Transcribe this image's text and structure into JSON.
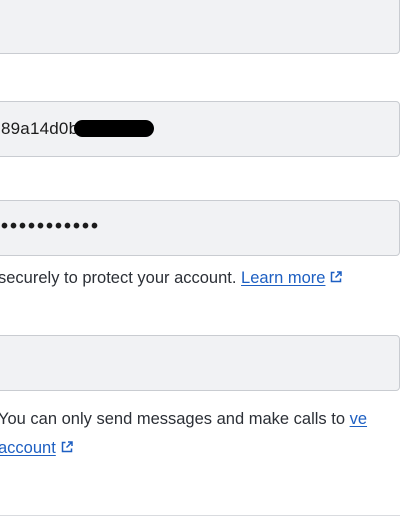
{
  "account_sid": {
    "value": "89a14d0b"
  },
  "auth_token": {
    "value": "•••••••••••"
  },
  "auth_token_help": {
    "text": " securely to protect your account. ",
    "link": "Learn more"
  },
  "phone_help": {
    "text": "You can only send messages and make calls to ",
    "link_partial": "ve",
    "line2_link": "account"
  },
  "colors": {
    "link": "#1d5fc2",
    "field_bg": "#f1f2f4",
    "field_border": "#c9ccd1"
  },
  "icons": {
    "external": "external-link-icon"
  }
}
